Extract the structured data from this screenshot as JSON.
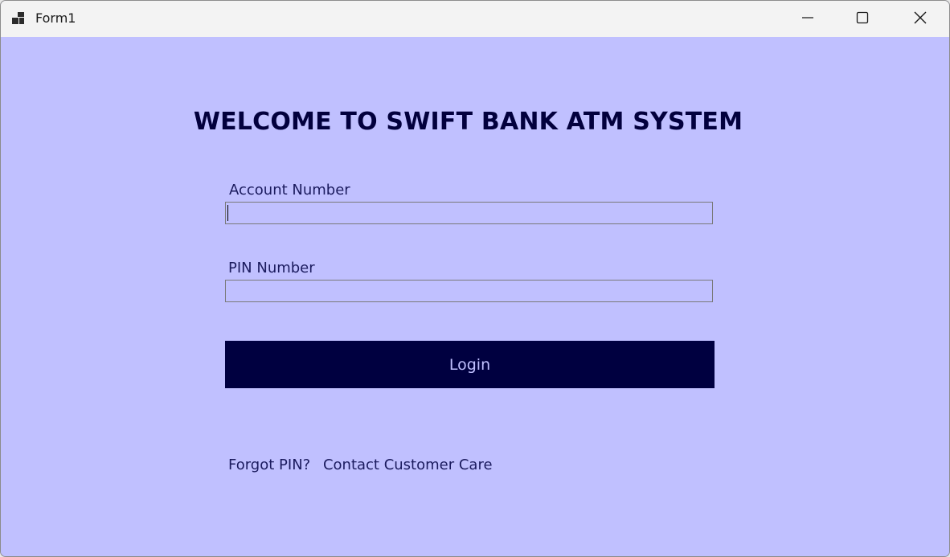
{
  "window": {
    "title": "Form1",
    "background": "#c0c0ff",
    "titlebar_background": "#f3f3f3",
    "controls": {
      "minimize_icon": "minimize-icon",
      "maximize_icon": "maximize-icon",
      "close_icon": "close-icon"
    }
  },
  "main": {
    "heading": "WELCOME TO SWIFT BANK ATM SYSTEM",
    "account_label": "Account Number",
    "account_value": "",
    "pin_label": "PIN Number",
    "pin_value": "",
    "login_label": "Login",
    "forgot_text": "Forgot PIN?",
    "contact_text": "Contact Customer Care"
  },
  "colors": {
    "heading": "#02003d",
    "label": "#1b1b5e",
    "button_background": "#000040",
    "button_text": "#c0c0ff"
  }
}
